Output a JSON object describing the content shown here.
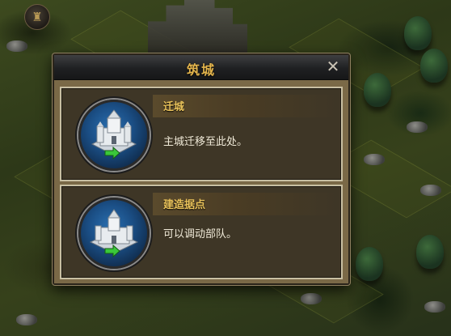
{
  "dialog": {
    "title": "筑城",
    "close_glyph": "✕"
  },
  "options": [
    {
      "title": "迁城",
      "description": "主城迁移至此处。",
      "icon": "castle-relocate-icon"
    },
    {
      "title": "建造据点",
      "description": "可以调动部队。",
      "icon": "outpost-build-icon"
    }
  ],
  "map": {
    "top_left_icon": "trophy-icon"
  },
  "colors": {
    "title_gold": "#e4b54c",
    "panel_title_gold": "#e9c25a",
    "emblem_blue": "#1b4f86",
    "arrow_green": "#3ac83a"
  }
}
